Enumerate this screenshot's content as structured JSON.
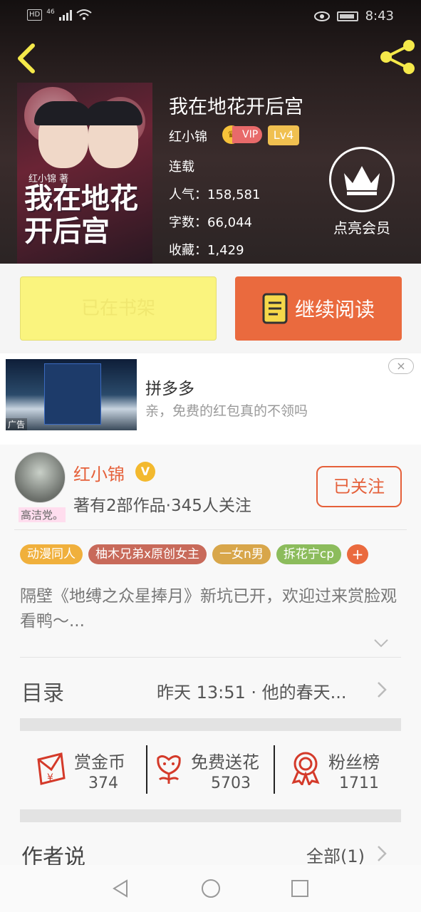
{
  "status_bar": {
    "network": "HD",
    "signal": "46",
    "time": "8:43"
  },
  "book": {
    "title": "我在地花开后宫",
    "author": "红小锦",
    "vip_label": "VIP",
    "level": "Lv4",
    "status": "连载",
    "popularity": "人气：158,581",
    "word_count": "字数：66,044",
    "favorites": "收藏：1,429",
    "cover_title": "我在地花开后宫",
    "cover_author": "红小锦 著",
    "member_label": "点亮会员"
  },
  "actions": {
    "shelf_label": "已在书架",
    "read_label": "继续阅读"
  },
  "ad": {
    "title": "拼多多",
    "desc": "亲，免费的红包真的不领吗",
    "label": "广告",
    "close": "×"
  },
  "author_card": {
    "name": "红小锦",
    "verified": "V",
    "stats": "著有2部作品·345人关注",
    "follow_label": "已关注",
    "avatar_tag": "高洁党。"
  },
  "tags": [
    "动漫同人",
    "柚木兄弟x原创女主",
    "一女n男",
    "拆花宁cp"
  ],
  "tag_colors": [
    "#f0b03c",
    "#c86a5a",
    "#d8a64a",
    "#8cbc5c"
  ],
  "tag_add": "+",
  "description": "隔壁《地缚之众星捧月》新坑已开，欢迎过来赏脸观看鸭～...",
  "toc": {
    "label": "目录",
    "latest": "昨天 13:51 · 他的春天..."
  },
  "stats": [
    {
      "label": "赏金币",
      "value": "374",
      "icon": "red-envelope-icon"
    },
    {
      "label": "免费送花",
      "value": "5703",
      "icon": "flower-icon"
    },
    {
      "label": "粉丝榜",
      "value": "1711",
      "icon": "medal-icon"
    }
  ],
  "author_say": {
    "label": "作者说",
    "all": "全部(1)"
  },
  "accent_color": "#ea6a3e"
}
